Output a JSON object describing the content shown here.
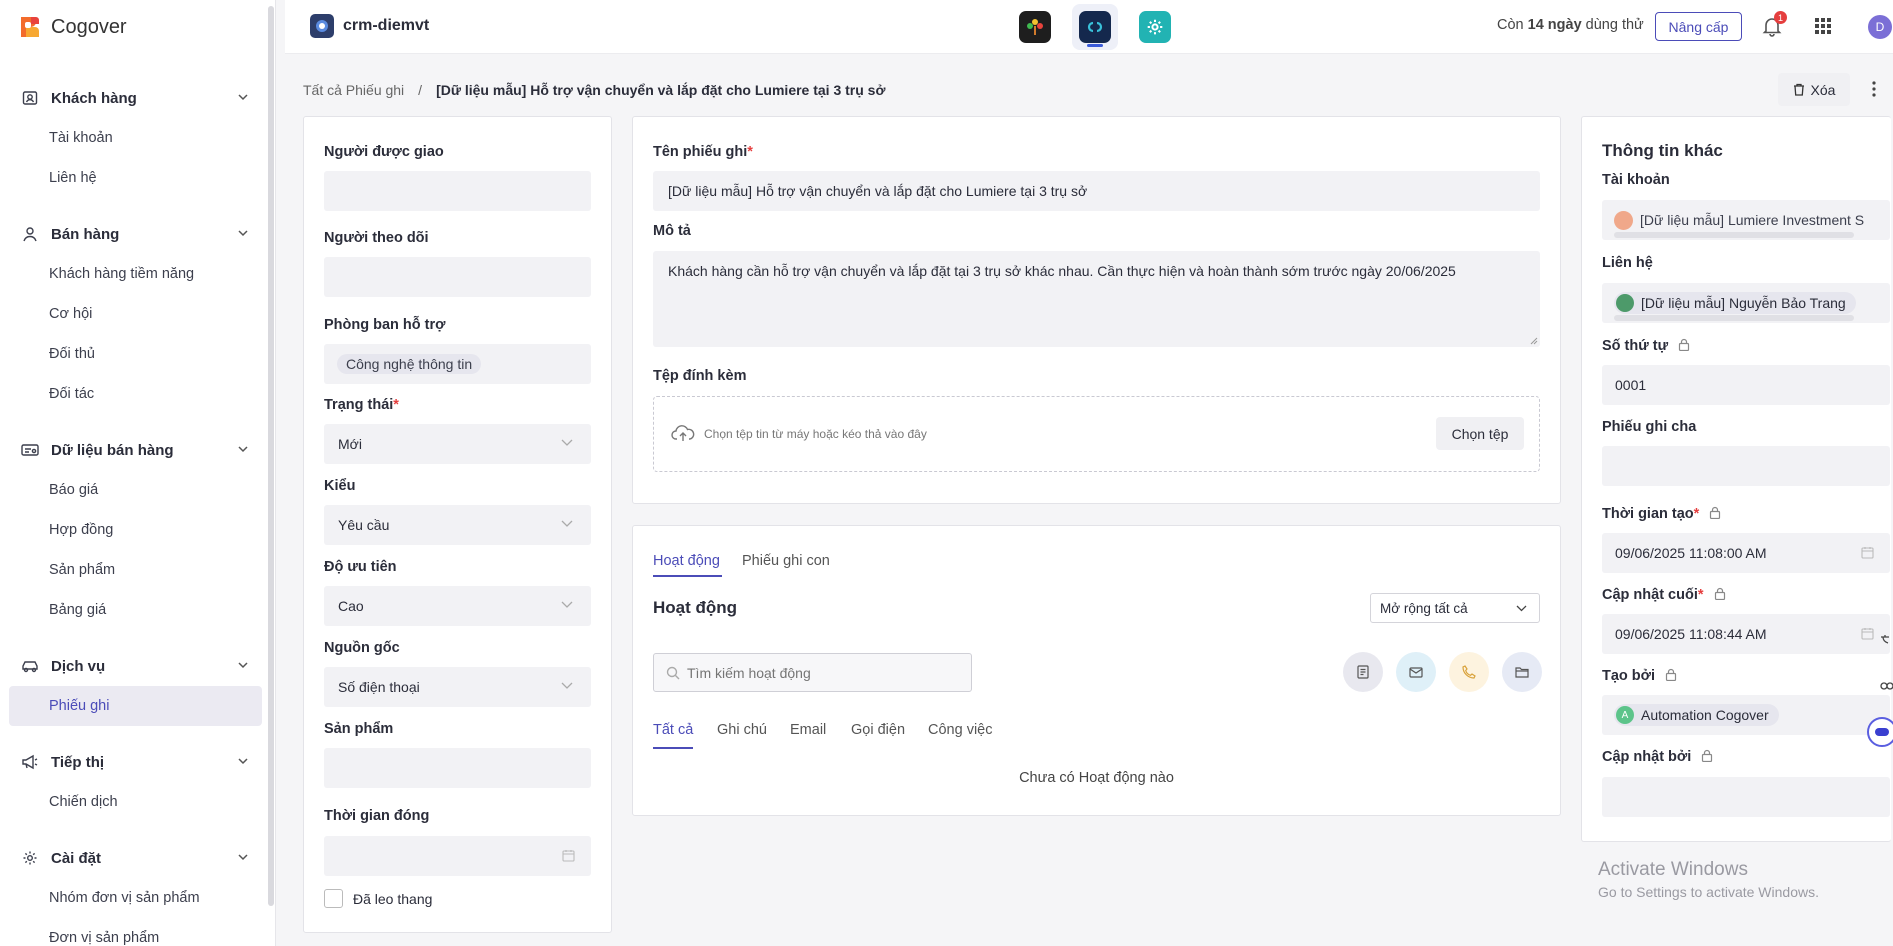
{
  "app": {
    "name": "Cogover"
  },
  "colors": {
    "accent": "#4b4cb8",
    "required": "#e53e3e"
  },
  "sidebar": {
    "groups": [
      {
        "label": "Khách hàng",
        "icon": "contact-card-icon",
        "items": [
          "Tài khoản",
          "Liên hệ"
        ]
      },
      {
        "label": "Bán hàng",
        "icon": "sales-person-icon",
        "items": [
          "Khách hàng tiềm năng",
          "Cơ hội",
          "Đối thủ",
          "Đối tác"
        ]
      },
      {
        "label": "Dữ liệu bán hàng",
        "icon": "ticket-icon",
        "items": [
          "Báo giá",
          "Hợp đồng",
          "Sản phẩm",
          "Bảng giá"
        ]
      },
      {
        "label": "Dịch vụ",
        "icon": "car-icon",
        "items": [
          "Phiếu ghi"
        ]
      },
      {
        "label": "Tiếp thị",
        "icon": "megaphone-icon",
        "items": [
          "Chiến dịch"
        ]
      },
      {
        "label": "Cài đặt",
        "icon": "gear-icon",
        "items": [
          "Nhóm đơn vị sản phẩm",
          "Đơn vị sản phẩm"
        ]
      }
    ],
    "active_item": "Phiếu ghi"
  },
  "header": {
    "workspace": "crm-diemvt",
    "trial_prefix": "Còn",
    "trial_days": "14 ngày",
    "trial_suffix": "dùng thử",
    "upgrade_label": "Nâng cấp",
    "notification_count": "1",
    "avatar_initial": "D"
  },
  "breadcrumb": {
    "root": "Tất cả Phiếu ghi",
    "separator": "/",
    "current": "[Dữ liệu mẫu] Hỗ trợ vận chuyển và lắp đặt cho Lumiere tại 3 trụ sở"
  },
  "actions": {
    "delete_label": "Xóa"
  },
  "left_panel": {
    "assignee_label": "Người được giao",
    "follower_label": "Người theo dõi",
    "department_label": "Phòng ban hỗ trợ",
    "department_value": "Công nghệ thông tin",
    "status_label": "Trạng thái",
    "status_value": "Mới",
    "type_label": "Kiểu",
    "type_value": "Yêu cầu",
    "priority_label": "Độ ưu tiên",
    "priority_value": "Cao",
    "origin_label": "Nguồn gốc",
    "origin_value": "Số điện thoại",
    "product_label": "Sản phẩm",
    "close_time_label": "Thời gian đóng",
    "escalated_label": "Đã leo thang"
  },
  "main": {
    "name_label": "Tên phiếu ghi",
    "name_value": "[Dữ liệu mẫu] Hỗ trợ vận chuyển và lắp đặt cho Lumiere tại 3 trụ sở",
    "desc_label": "Mô tả",
    "desc_value": "Khách hàng cần hỗ trợ vận chuyển và lắp đặt tại 3 trụ sở khác nhau. Cần thực hiện và hoàn thành sớm trước ngày 20/06/2025",
    "attach_label": "Tệp đính kèm",
    "attach_hint": "Chọn tệp tin từ máy hoặc kéo thả vào đây",
    "choose_file": "Chọn tệp"
  },
  "activity": {
    "tabs": [
      "Hoạt động",
      "Phiếu ghi con"
    ],
    "title": "Hoạt động",
    "expand_label": "Mở rộng tất cả",
    "search_placeholder": "Tìm kiếm hoạt động",
    "filters": [
      "Tất cả",
      "Ghi chú",
      "Email",
      "Gọi điện",
      "Công việc"
    ],
    "empty": "Chưa có Hoạt động nào"
  },
  "right_panel": {
    "title": "Thông tin khác",
    "account_label": "Tài khoản",
    "account_value": "[Dữ liệu mẫu] Lumiere Investment S",
    "contact_label": "Liên hệ",
    "contact_value": "[Dữ liệu mẫu] Nguyễn Bảo Trang",
    "order_label": "Số thứ tự",
    "order_value": "0001",
    "parent_label": "Phiếu ghi cha",
    "created_label": "Thời gian tạo",
    "created_value": "09/06/2025 11:08:00 AM",
    "updated_label": "Cập nhật cuối",
    "updated_value": "09/06/2025 11:08:44 AM",
    "created_by_label": "Tạo bởi",
    "created_by_value": "Automation Cogover",
    "created_by_initial": "A",
    "updated_by_label": "Cập nhật bởi"
  },
  "watermark": {
    "line1": "Activate Windows",
    "line2": "Go to Settings to activate Windows."
  }
}
